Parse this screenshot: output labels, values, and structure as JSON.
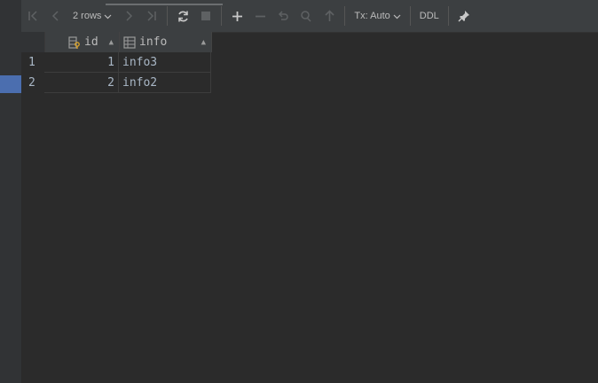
{
  "toolbar": {
    "rows_label": "2 rows",
    "tx_label": "Tx: Auto",
    "ddl_label": "DDL"
  },
  "grid": {
    "columns": [
      {
        "name": "id",
        "icon": "key-column-icon"
      },
      {
        "name": "info",
        "icon": "column-icon"
      }
    ],
    "rows": [
      {
        "num": "1",
        "id": "1",
        "info": "info3"
      },
      {
        "num": "2",
        "id": "2",
        "info": "info2"
      }
    ]
  }
}
